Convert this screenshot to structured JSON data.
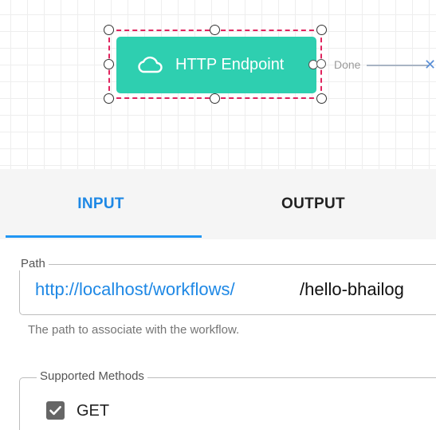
{
  "canvas": {
    "node": {
      "label": "HTTP Endpoint",
      "icon": "cloud-icon",
      "color": "#2ecfb0",
      "selection_color": "#e0245e"
    },
    "edge": {
      "label": "Done"
    }
  },
  "tabs": [
    {
      "label": "INPUT",
      "active": true
    },
    {
      "label": "OUTPUT",
      "active": false
    }
  ],
  "path_field": {
    "legend": "Path",
    "prefix": "http://localhost/workflows/",
    "value": "/hello-bhailog",
    "helper": "The path to associate with the workflow."
  },
  "methods_field": {
    "legend": "Supported Methods",
    "options": [
      {
        "label": "GET",
        "checked": true
      }
    ]
  },
  "colors": {
    "accent": "#1e88e5",
    "tab_indicator": "#2196f3"
  }
}
